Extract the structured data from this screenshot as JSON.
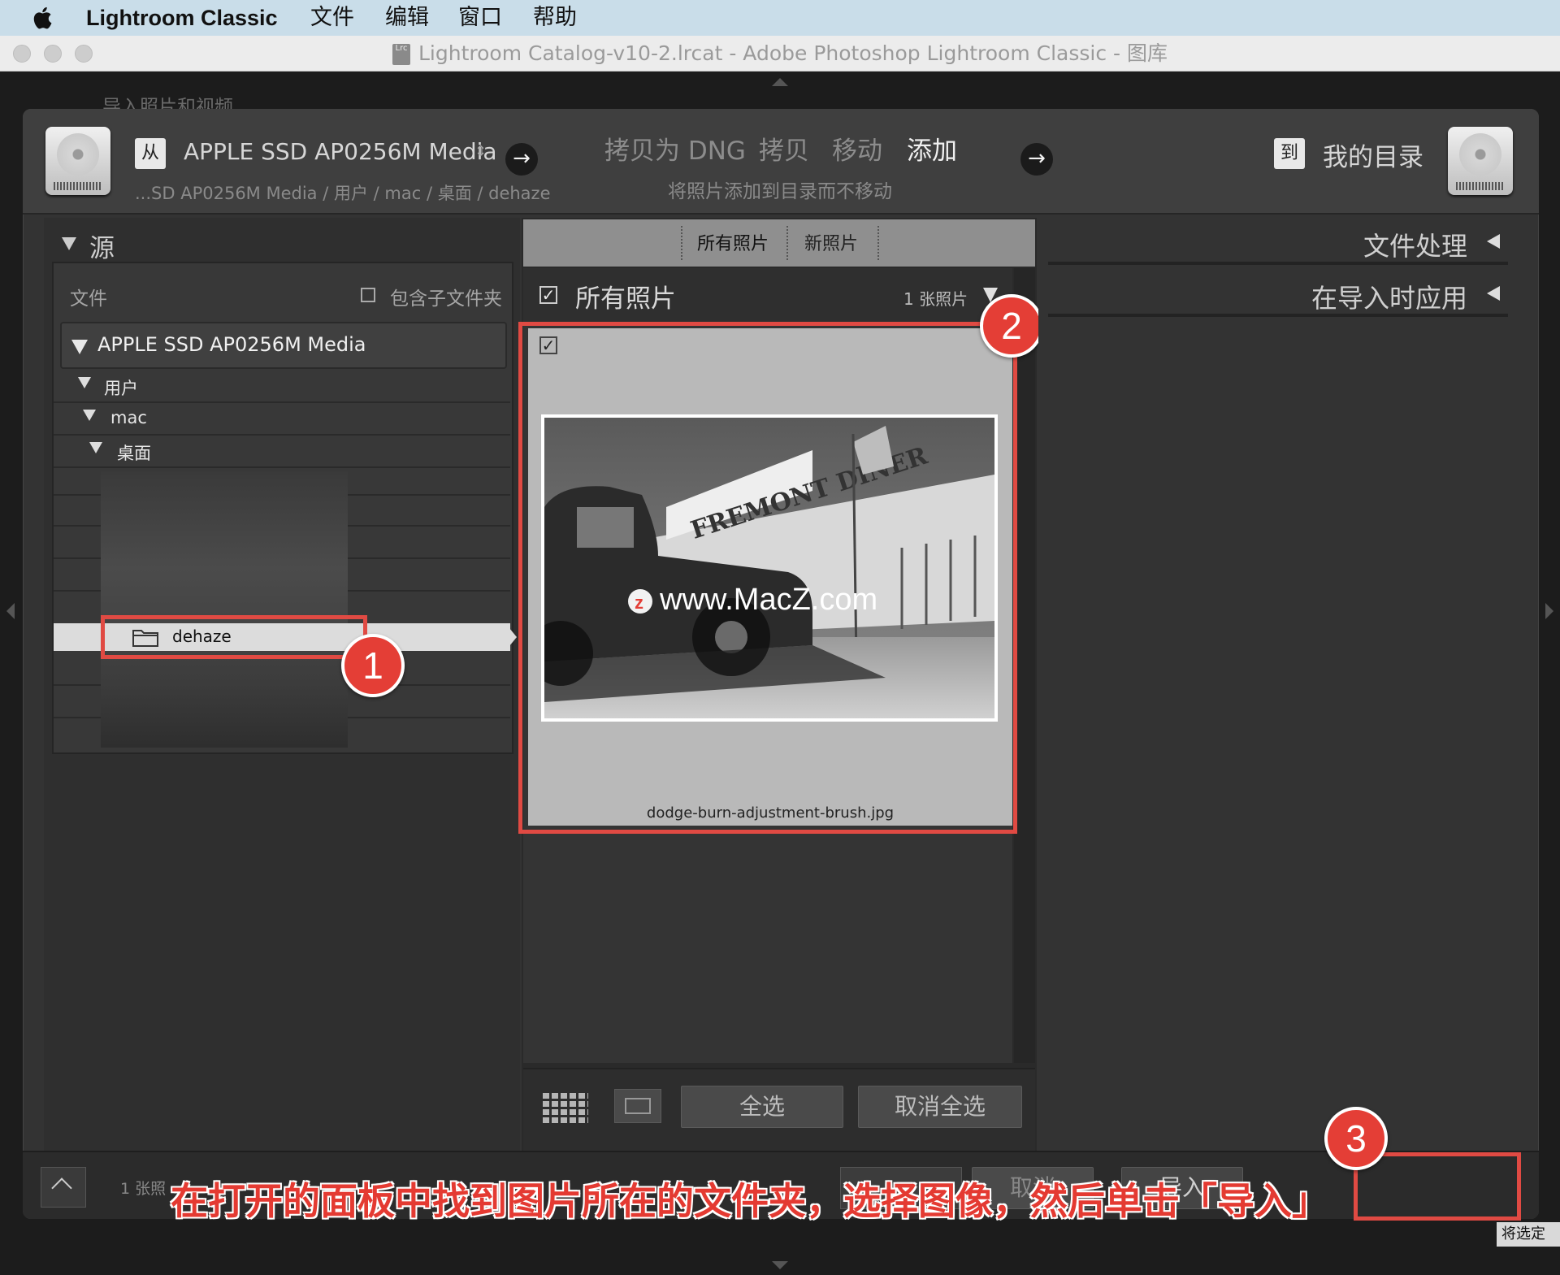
{
  "menubar": {
    "app_name": "Lightroom Classic",
    "items": [
      "文件",
      "编辑",
      "窗口",
      "帮助"
    ]
  },
  "window": {
    "title": "Lightroom Catalog-v10-2.lrcat - Adobe Photoshop Lightroom Classic - 图库",
    "badge": "Lrc",
    "background_label": "导入照片和视频"
  },
  "header": {
    "from_tag": "从",
    "source_name": "APPLE SSD AP0256M Media",
    "source_path": "...SD AP0256M Media / 用户 / mac / 桌面 / dehaze",
    "modes": [
      "拷贝为 DNG",
      "拷贝",
      "移动",
      "添加"
    ],
    "active_mode": "添加",
    "mode_description": "将照片添加到目录而不移动",
    "to_tag": "到",
    "destination_name": "我的目录"
  },
  "source_panel": {
    "title": "源",
    "files_label": "文件",
    "include_subfolders": "包含子文件夹",
    "volume": "APPLE SSD AP0256M Media",
    "tree": [
      "用户",
      "mac",
      "桌面"
    ],
    "selected_folder": "dehaze"
  },
  "center": {
    "tabs": [
      "所有照片",
      "新照片"
    ],
    "grid_title": "所有照片",
    "photo_count": "1 张照片",
    "thumbnail_filename": "dodge-burn-adjustment-brush.jpg",
    "watermark": "www.MacZ.com",
    "sign_text": "FREMONT DINER",
    "select_all": "全选",
    "deselect_all": "取消全选"
  },
  "right_panel": {
    "sections": [
      "文件处理",
      "在导入时应用"
    ]
  },
  "footer": {
    "count_text": "1 张照",
    "import_button": "导入",
    "cancel_button": "取消",
    "corner_text": "将选定"
  },
  "annotations": {
    "badges": [
      "1",
      "2",
      "3"
    ],
    "caption": "在打开的面板中找到图片所在的文件夹，选择图像，然后单击「导入」"
  },
  "colors": {
    "accent_red": "#e43e36",
    "menubar_bg": "#c9dde9",
    "dialog_bg": "#333333"
  }
}
